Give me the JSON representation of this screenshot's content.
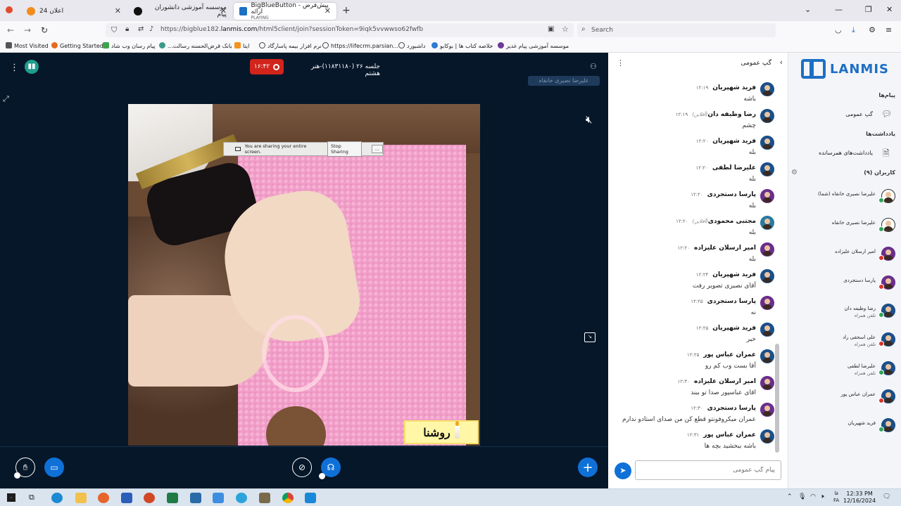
{
  "browser": {
    "tabs": [
      {
        "title": "اعلان 24",
        "subtitle": ""
      },
      {
        "title": "موسسه آموزشی دانشوران پیام",
        "subtitle": ""
      },
      {
        "title": "BigBlueButton - پیش‌فرض ارائه",
        "subtitle": "PLAYING"
      }
    ],
    "url_prefix": "https://bigblue182.",
    "url_domain": "lanmis.com",
    "url_rest": "/html5client/join?sessionToken=9iqk5vvwwso62fwfb",
    "search_placeholder": "Search",
    "bookmarks": [
      "Most Visited",
      "Getting Started",
      "پیام رسان وب شاد",
      "...بانک قرض‌الحسنه رسالت",
      "ایتا",
      "نرم افزار بیمه پاسارگاد",
      "https://lifecrm.parsian...",
      "داشبورد",
      "خلاصه کتاب ها | بوکابو",
      "موسسه آموزشی پیام غدیر"
    ]
  },
  "meeting": {
    "timer": "۱۶:۴۲",
    "title": "جلسه ۲۶ (۱۱۸۳۱۱۸۰)-هنر هشتم",
    "presenter": "علیرضا نصیری خانقاه"
  },
  "screen_share": {
    "message": "You are sharing your entire screen.",
    "stop_label": "Stop Sharing",
    "more_label": "..."
  },
  "overlay_logo": "روشنا",
  "chat": {
    "title": "گپ عمومی",
    "input_placeholder": "پیام گپ عمومی",
    "messages": [
      {
        "name": "فرید شهپریان",
        "time": "۱۲:۱۹",
        "offline": "",
        "text": "باشه"
      },
      {
        "name": "رضا وظیفه دان",
        "time": "۱۲:۱۹",
        "offline": "(آفلاین)",
        "text": "چشم"
      },
      {
        "name": "فرید شهپریان",
        "time": "۱۲:۲۰",
        "offline": "",
        "text": "بله"
      },
      {
        "name": "علیرضا لطفی",
        "time": "۱۲:۲۰",
        "offline": "",
        "text": "بله"
      },
      {
        "name": "پارسا دستجردی",
        "time": "۱۲:۲۰",
        "offline": "",
        "text": "بله"
      },
      {
        "name": "مجتبی محمودی",
        "time": "۱۲:۲۰",
        "offline": "(آفلاین)",
        "text": "بله"
      },
      {
        "name": "امیر ارسلان علیزاده",
        "time": "۱۲:۲۰",
        "offline": "",
        "text": "بله"
      },
      {
        "name": "فرید شهپریان",
        "time": "۱۲:۲۴",
        "offline": "",
        "text": "آقای نصیری تصویر رفت"
      },
      {
        "name": "پارسا دستجردی",
        "time": "۱۲:۲۵",
        "offline": "",
        "text": "نه"
      },
      {
        "name": "فرید شهپریان",
        "time": "۱۲:۲۵",
        "offline": "",
        "text": "خیر"
      },
      {
        "name": "عمران عباس پور",
        "time": "۱۲:۲۵",
        "offline": "",
        "text": "آقا بست وب کم رو"
      },
      {
        "name": "امیر ارسلان علیزاده",
        "time": "۱۲:۳۰",
        "offline": "",
        "text": "اقای عباسپور صدا تو ببند"
      },
      {
        "name": "پارسا دستجردی",
        "time": "۱۲:۳۰",
        "offline": "",
        "text": "عمران میکروفونتو قطع کن من صدای استادو ندارم"
      },
      {
        "name": "عمران عباس پور",
        "time": "۱۲:۳۱",
        "offline": "",
        "text": "باشه ببخشید بچه ها"
      }
    ]
  },
  "sidebar": {
    "brand": "LANMIS",
    "messages_heading": "پیام‌ها",
    "public_chat": "گپ عمومی",
    "notes_heading": "یادداشت‌ها",
    "shared_notes": "یادداشت‌های همرسانده",
    "users_heading": "کاربران (۹)",
    "users": [
      {
        "name": "علیرضا نصیری خانقاه (شما)",
        "sub": "",
        "mic": "green"
      },
      {
        "name": "علیرضا نصیری خانقاه",
        "sub": "",
        "mic": "green"
      },
      {
        "name": "امیر ارسلان علیزاده",
        "sub": "",
        "mic": "red"
      },
      {
        "name": "پارسا دستجردی",
        "sub": "",
        "mic": "red"
      },
      {
        "name": "رضا وظیفه دان",
        "sub": "تلفن همراه",
        "mic": "green"
      },
      {
        "name": "علی اسحقی راد",
        "sub": "تلفن همراه",
        "mic": "red"
      },
      {
        "name": "علیرضا لطفی",
        "sub": "تلفن همراه",
        "mic": "green"
      },
      {
        "name": "عمران عباس پور",
        "sub": "",
        "mic": "red"
      },
      {
        "name": "فرید شهپریان",
        "sub": "",
        "mic": "green"
      }
    ]
  },
  "taskbar": {
    "time": "12:33 PM",
    "date": "12/16/2024",
    "lang": "FA",
    "lang_top": "فا"
  }
}
